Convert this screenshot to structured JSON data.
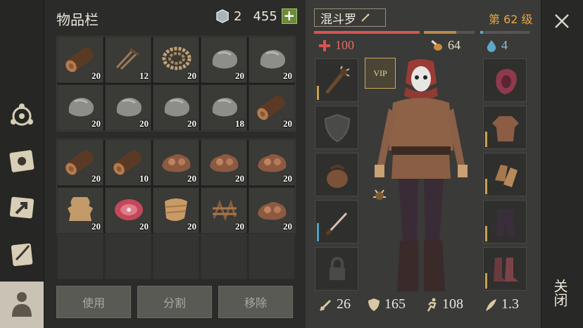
{
  "inventory": {
    "title": "物品栏",
    "silver": "2",
    "gold": "455",
    "add_label": "+",
    "top_grid": [
      {
        "icon": "log-icon",
        "qty": "20"
      },
      {
        "icon": "nails-icon",
        "qty": "12"
      },
      {
        "icon": "rope-icon",
        "qty": "20"
      },
      {
        "icon": "stone-icon",
        "qty": "20"
      },
      {
        "icon": "stone-icon",
        "qty": "20"
      },
      {
        "icon": "stone-icon",
        "qty": "20"
      },
      {
        "icon": "stone-icon",
        "qty": "20"
      },
      {
        "icon": "stone-icon",
        "qty": "20"
      },
      {
        "icon": "stone-icon",
        "qty": "18"
      },
      {
        "icon": "log-icon",
        "qty": "20"
      }
    ],
    "bottom_grid": [
      {
        "icon": "log-icon",
        "qty": "20"
      },
      {
        "icon": "log-icon",
        "qty": "10"
      },
      {
        "icon": "copper-ore-icon",
        "qty": "20"
      },
      {
        "icon": "copper-ore-icon",
        "qty": "20"
      },
      {
        "icon": "copper-ore-icon",
        "qty": "20"
      },
      {
        "icon": "hide-icon",
        "qty": "20"
      },
      {
        "icon": "raw-meat-icon",
        "qty": "20"
      },
      {
        "icon": "cloth-icon",
        "qty": "20"
      },
      {
        "icon": "twine-icon",
        "qty": "20"
      },
      {
        "icon": "copper-ore-icon",
        "qty": "20"
      }
    ],
    "buttons": {
      "use": "使用",
      "split": "分割",
      "remove": "移除"
    }
  },
  "character": {
    "name": "混斗罗",
    "level": "第 62 级",
    "health": "100",
    "food": "64",
    "water": "4",
    "vip": "VIP",
    "health_fraction": 1.0,
    "food_fraction": 0.64,
    "water_fraction": 0.05,
    "attack": "26",
    "defense": "165",
    "speed": "108",
    "weight": "1.3",
    "left_slots": [
      "spiked-club-icon",
      "shield-icon",
      "pouch-icon",
      "dagger-icon",
      "lock-icon"
    ],
    "right_slots": [
      "hood-icon",
      "tunic-icon",
      "gloves-icon",
      "pants-icon",
      "boots-icon"
    ]
  },
  "close": {
    "label": "关闭"
  },
  "colors": {
    "health": "#d9534f",
    "food": "#b88a45",
    "water": "#5fa7c6",
    "level": "#e6a845"
  }
}
